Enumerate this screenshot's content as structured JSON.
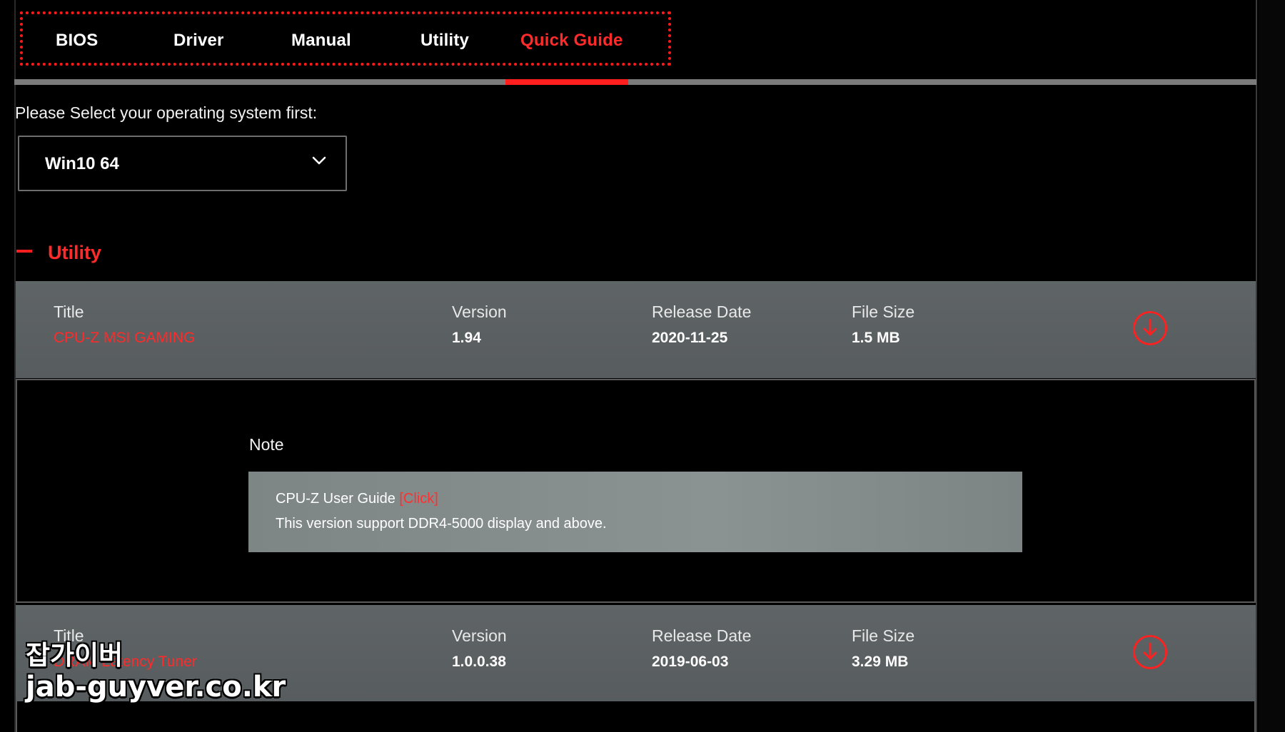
{
  "tabs": [
    {
      "label": "BIOS",
      "active": false
    },
    {
      "label": "Driver",
      "active": false
    },
    {
      "label": "Manual",
      "active": false
    },
    {
      "label": "Utility",
      "active": false
    },
    {
      "label": "Quick Guide",
      "active": true
    }
  ],
  "os_select": {
    "label": "Please Select your operating system first:",
    "value": "Win10 64"
  },
  "section": {
    "title": "Utility"
  },
  "columns": {
    "title": "Title",
    "version": "Version",
    "release_date": "Release Date",
    "file_size": "File Size"
  },
  "items": [
    {
      "title": "CPU-Z MSI GAMING",
      "version": "1.94",
      "release_date": "2020-11-25",
      "file_size": "1.5 MB",
      "note": {
        "heading": "Note",
        "line1_text": "CPU-Z User Guide ",
        "line1_link": "[Click]",
        "line2_text": "This version support DDR4-5000 display and above."
      }
    },
    {
      "title": "DRAM Latency Tuner",
      "version": "1.0.0.38",
      "release_date": "2019-06-03",
      "file_size": "3.29 MB"
    }
  ],
  "watermark": {
    "korean": "잡가이버",
    "url": "jab-guyver.co.kr"
  },
  "colors": {
    "accent": "#ff2a2a",
    "row_bg": "#5f6466",
    "note_bg": "#858d8d",
    "background": "#000000"
  },
  "icons": {
    "dropdown": "chevron-down-icon",
    "download": "download-circle-icon"
  }
}
